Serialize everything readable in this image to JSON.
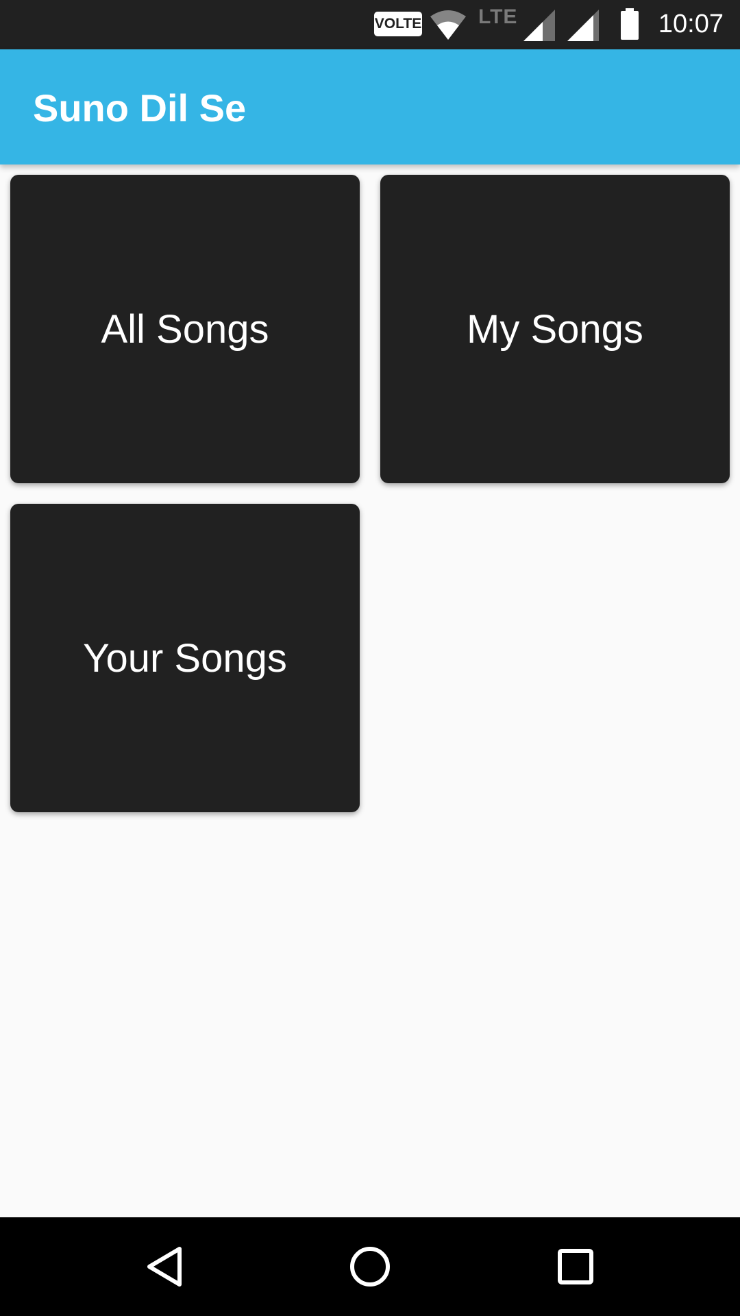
{
  "status_bar": {
    "volte_label": "VOLTE",
    "network_label": "LTE",
    "time": "10:07",
    "icons": [
      "volte-icon",
      "wifi-icon",
      "signal-icon",
      "signal-icon",
      "battery-icon"
    ]
  },
  "app_bar": {
    "title": "Suno Dil Se",
    "color": "#35b5e5"
  },
  "tiles": [
    {
      "label": "All Songs"
    },
    {
      "label": "My Songs"
    },
    {
      "label": "Your Songs"
    }
  ],
  "nav_bar": {
    "icons": [
      "back-icon",
      "home-icon",
      "recents-icon"
    ]
  },
  "colors": {
    "tile_background": "#212121",
    "page_background": "#fafafa",
    "status_bar": "#212121"
  }
}
